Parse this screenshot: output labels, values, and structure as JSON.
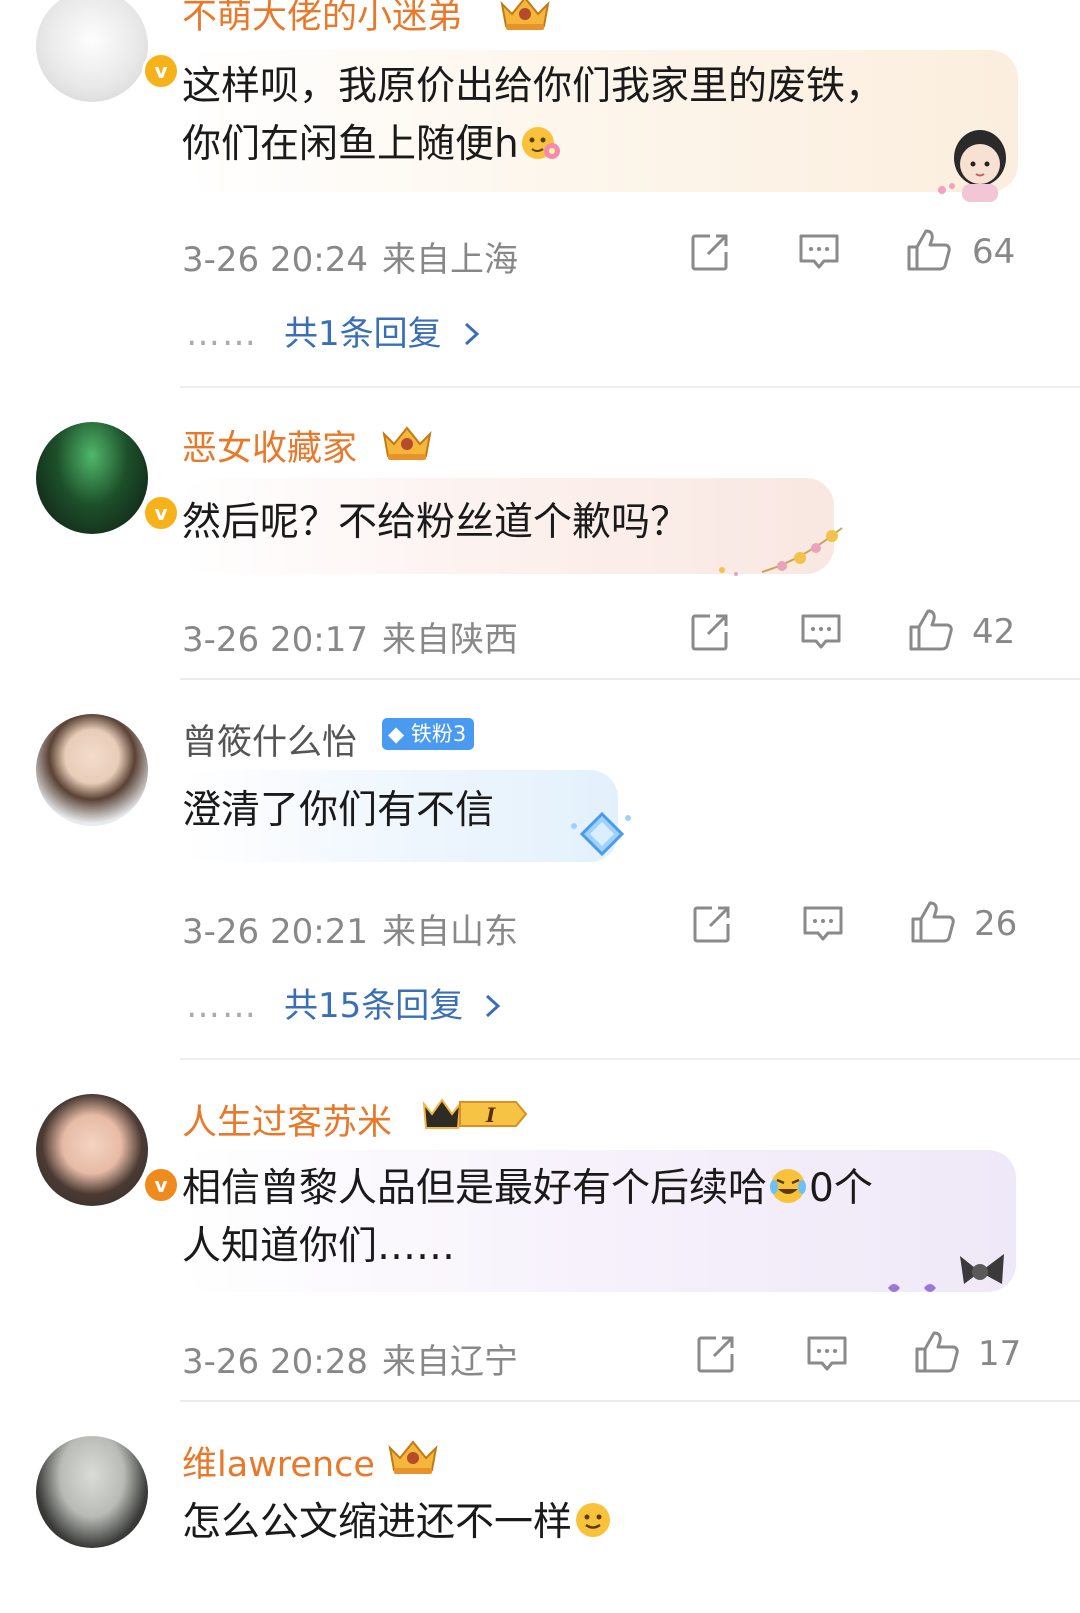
{
  "comments": [
    {
      "username": "不萌大佬的小迷弟",
      "text_lines": [
        "这样呗，我原价出给你们我家里的废铁，",
        "你们在闲鱼上随便h"
      ],
      "time": "3-26 20:24",
      "location": "来自上海",
      "likes": "64",
      "replies_label": "共1条回复",
      "dots": "……"
    },
    {
      "username": "恶女收藏家",
      "text_lines": [
        "然后呢？不给粉丝道个歉吗？"
      ],
      "time": "3-26 20:17",
      "location": "来自陕西",
      "likes": "42"
    },
    {
      "username": "曾筱什么怡",
      "fan_badge": "铁粉3",
      "text_lines": [
        "澄清了你们有不信"
      ],
      "time": "3-26 20:21",
      "location": "来自山东",
      "likes": "26",
      "replies_label": "共15条回复",
      "dots": "……"
    },
    {
      "username": "人生过客苏米",
      "level_badge": "I",
      "text_lines": [
        "相信曾黎人品但是最好有个后续哈",
        "人知道你们……"
      ],
      "text_line1_tail": "0个",
      "time": "3-26 20:28",
      "location": "来自辽宁",
      "likes": "17"
    },
    {
      "username": "维lawrence",
      "text_lines": [
        "怎么公文缩进还不一样"
      ]
    }
  ],
  "icons": {
    "share": "share-icon",
    "comment": "comment-icon",
    "like": "thumbs-up-icon",
    "verified": "verified-v-badge",
    "crown": "crown-badge-icon",
    "chevron": "chevron-right-icon"
  },
  "colors": {
    "username_vip": "#e8792a",
    "username_normal": "#555555",
    "reply_link": "#3a6fb7",
    "meta": "#888888",
    "verified_badge": "#f7b21a"
  },
  "verified_mark": "v"
}
